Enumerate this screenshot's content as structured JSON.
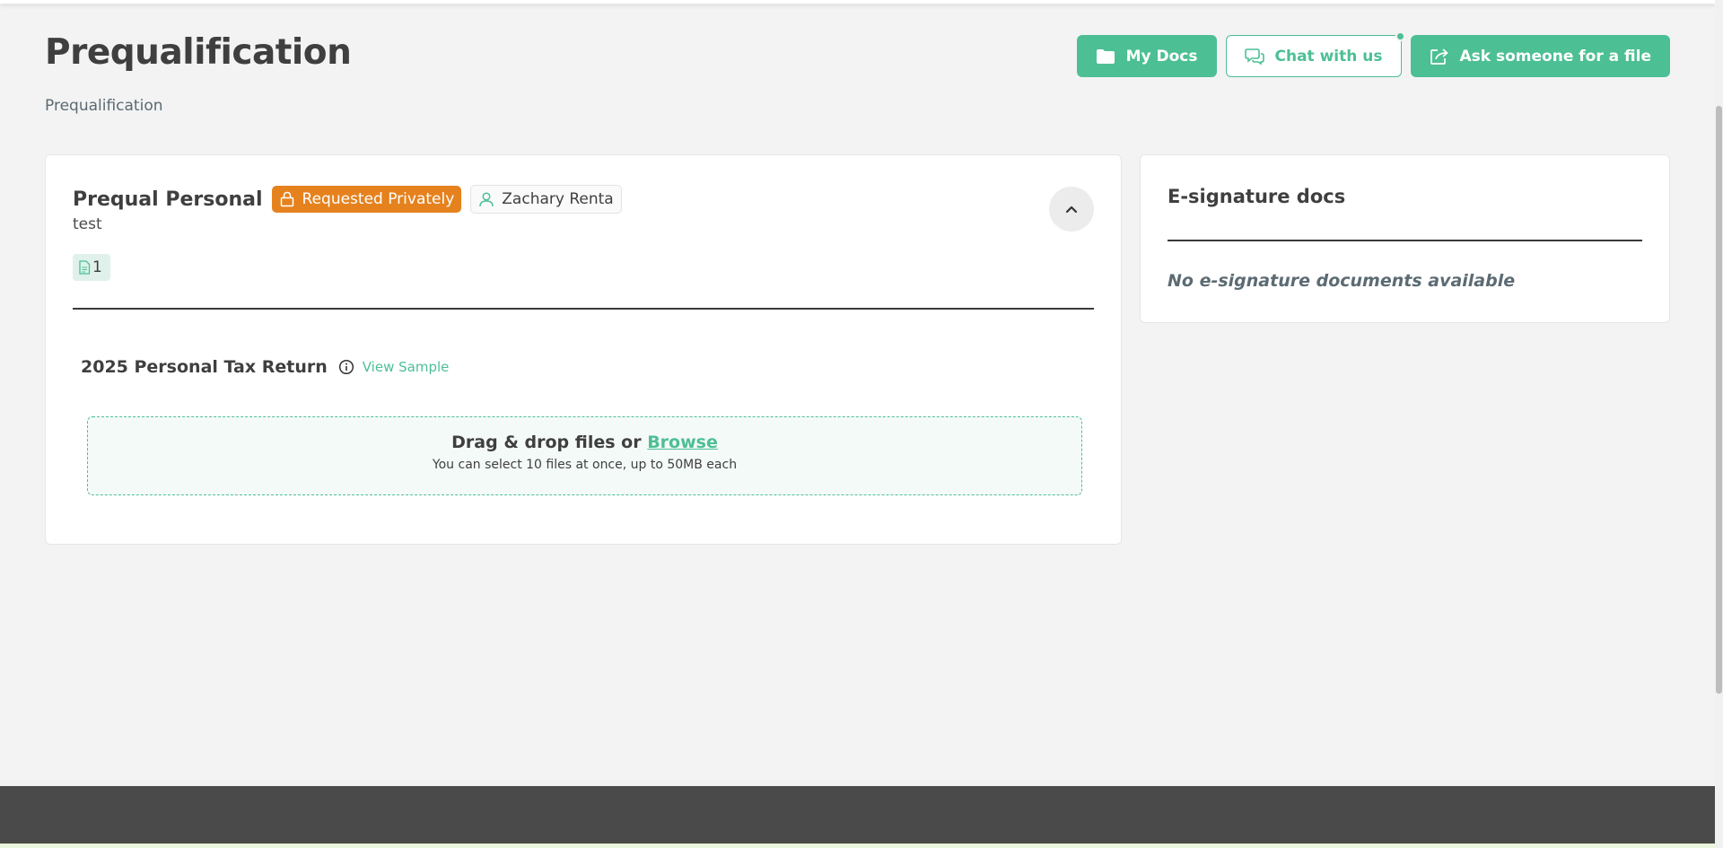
{
  "page": {
    "title": "Prequalification",
    "breadcrumb": "Prequalification"
  },
  "actions": {
    "my_docs": "My Docs",
    "chat": "Chat with us",
    "ask": "Ask someone for a file"
  },
  "request": {
    "title": "Prequal Personal",
    "badge_private": "Requested Privately",
    "assignee": "Zachary Renta",
    "description": "test",
    "doc_count": "1",
    "item_title": "2025 Personal Tax Return",
    "view_sample": "View Sample",
    "dropzone_text": "Drag & drop files or",
    "browse_label": "Browse",
    "dropzone_hint": "You can select 10 files at once, up to 50MB each"
  },
  "esign": {
    "title": "E-signature docs",
    "empty": "No e-signature documents available"
  },
  "colors": {
    "accent": "#4dbf95",
    "private_badge": "#e5821e",
    "footer": "#4a4a4a"
  },
  "icons": {
    "my_docs": "folder-icon",
    "chat": "chat-bubbles-icon",
    "ask": "share-icon",
    "private": "lock-icon",
    "assignee": "user-icon",
    "doc_count": "document-icon",
    "collapse": "chevron-up-icon",
    "info": "info-icon"
  }
}
